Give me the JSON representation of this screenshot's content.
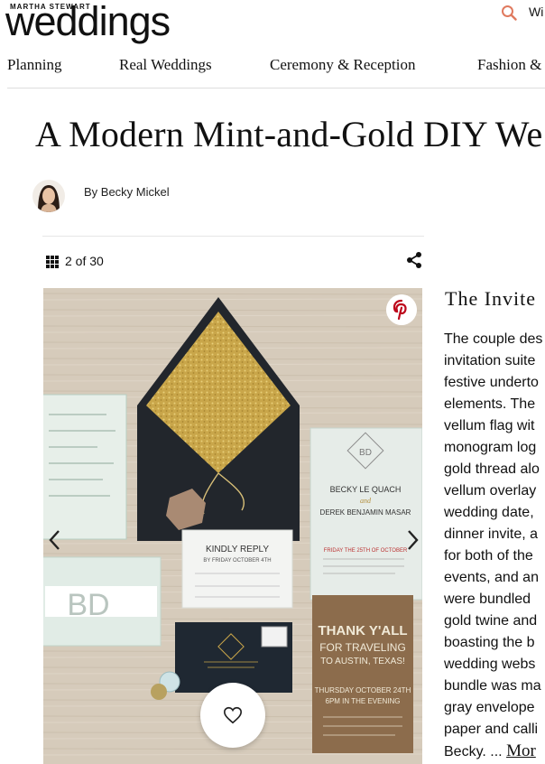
{
  "header": {
    "brand_kicker": "MARTHA STEWART",
    "brand": "weddings",
    "search_cut_text": "Wi"
  },
  "nav": {
    "items": [
      {
        "label": "Planning"
      },
      {
        "label": "Real Weddings"
      },
      {
        "label": "Ceremony & Reception"
      },
      {
        "label": "Fashion &"
      }
    ]
  },
  "article": {
    "title": "A Modern Mint-and-Gold DIY We",
    "byline": "By Becky Mickel"
  },
  "gallery": {
    "counter": "2 of 30"
  },
  "caption": {
    "title": "The Invite",
    "lines": [
      "The couple des",
      "invitation suite",
      "festive underto",
      "elements. The",
      "vellum flag wit",
      "monogram log",
      "gold thread alo",
      "vellum overlay",
      "wedding date,",
      "dinner invite, a",
      "for both of the",
      "events, and an",
      "were bundled",
      "gold twine and",
      "boasting the b",
      "wedding webs",
      "bundle was ma",
      "gray envelope",
      "paper and calli",
      "Becky. ..."
    ],
    "more": "Mor"
  },
  "photo": {
    "reply_card": {
      "line1": "KINDLY REPLY",
      "line2": "BY FRIDAY OCTOBER 4TH"
    },
    "travel_card": {
      "line1": "THANK Y'ALL",
      "line2": "FOR TRAVELING",
      "line3": "TO AUSTIN, TEXAS!",
      "line4": "THURSDAY OCTOBER 24TH",
      "line5": "6PM IN THE EVENING"
    },
    "monogram": "BD",
    "names": {
      "bride": "BECKY LE QUACH",
      "and": "and",
      "groom": "DEREK BENJAMIN MASAR",
      "date": "FRIDAY THE 25TH OF OCTOBER"
    }
  }
}
